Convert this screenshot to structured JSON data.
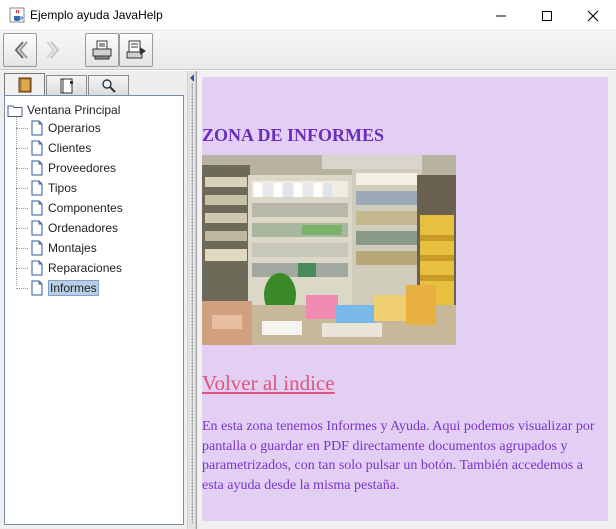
{
  "window": {
    "title": "Ejemplo ayuda JavaHelp",
    "icon": "java-cup-icon"
  },
  "toolbar": {
    "buttons": [
      {
        "name": "back",
        "icon": "chevron-left-icon",
        "enabled": true
      },
      {
        "name": "forward",
        "icon": "chevron-right-icon",
        "enabled": false
      },
      {
        "name": "print",
        "icon": "printer-icon",
        "enabled": true
      },
      {
        "name": "page-setup",
        "icon": "page-setup-icon",
        "enabled": true
      }
    ]
  },
  "navigator": {
    "tabs": [
      {
        "name": "table-of-contents",
        "icon": "book-icon",
        "active": true
      },
      {
        "name": "index",
        "icon": "index-book-icon",
        "active": false
      },
      {
        "name": "search",
        "icon": "magnifier-icon",
        "active": false
      }
    ],
    "root": "Ventana Principal",
    "items": [
      "Operarios",
      "Clientes",
      "Proveedores",
      "Tipos",
      "Componentes",
      "Ordenadores",
      "Montajes",
      "Reparaciones",
      "Informes"
    ],
    "selected": "Informes"
  },
  "content": {
    "title": "ZONA DE INFORMES",
    "image": "office-shelves-with-binders-photo",
    "link": "Volver al indice",
    "paragraph": "En esta zona tenemos Informes y Ayuda. Aqui podemos visualizar por pantalla o guardar en PDF directamente documentos agrupados y parametrizados, con tan solo pulsar un botón. También accedemos a esta ayuda desde la misma pestaña."
  },
  "colors": {
    "content_bg": "#e3cff3",
    "title": "#6a2dc0",
    "link": "#e0557a",
    "text": "#7a35c8",
    "selection": "#b8cfe5"
  }
}
